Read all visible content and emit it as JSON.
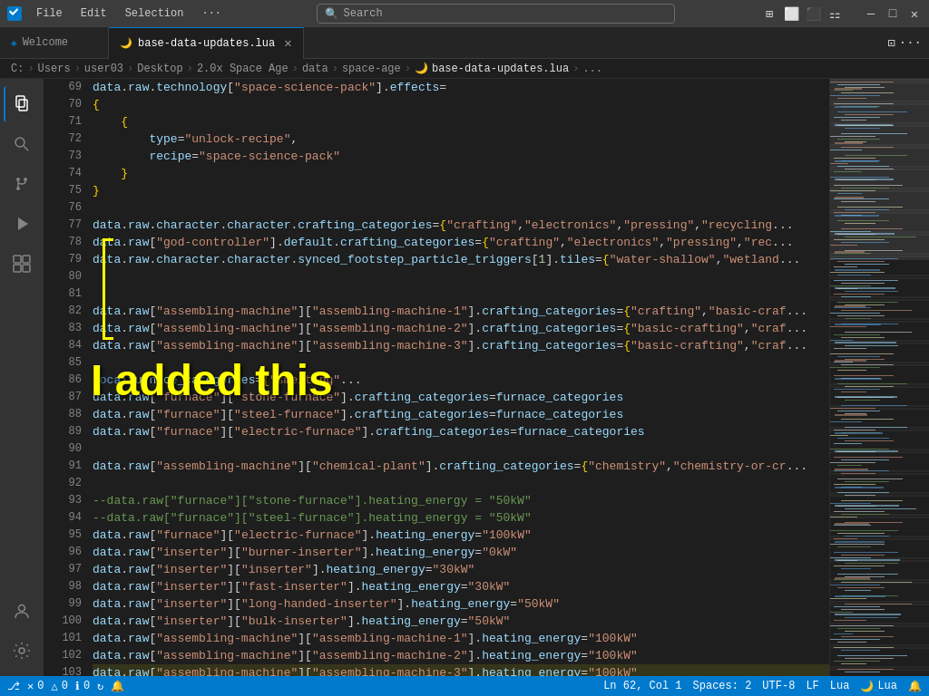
{
  "titleBar": {
    "appIcon": "vscode-icon",
    "menus": [
      "File",
      "Edit",
      "Selection",
      "..."
    ],
    "searchPlaceholder": "Search",
    "windowControls": [
      "minimize",
      "maximize-restore",
      "close"
    ]
  },
  "tabs": [
    {
      "id": "welcome",
      "label": "Welcome",
      "icon": "vscode-icon",
      "active": false,
      "closable": false
    },
    {
      "id": "base-data-updates",
      "label": "base-data-updates.lua",
      "icon": "lua-icon",
      "active": true,
      "closable": true
    }
  ],
  "breadcrumb": {
    "parts": [
      "C:",
      "Users",
      "user03",
      "Desktop",
      "2.0x Space Age",
      "data",
      "space-age",
      "base-data-updates.lua",
      "..."
    ]
  },
  "lines": [
    {
      "num": 69,
      "code": "data.raw.technology[\"space-science-pack\"].effects ="
    },
    {
      "num": 70,
      "code": "{"
    },
    {
      "num": 71,
      "code": "  {"
    },
    {
      "num": 72,
      "code": "    type = \"unlock-recipe\","
    },
    {
      "num": 73,
      "code": "    recipe = \"space-science-pack\""
    },
    {
      "num": 74,
      "code": "  }"
    },
    {
      "num": 75,
      "code": "}"
    },
    {
      "num": 76,
      "code": ""
    },
    {
      "num": 77,
      "code": "data.raw.character.character.crafting_categories = {\"crafting\", \"electronics\", \"pressing\", \"recycling..."
    },
    {
      "num": 78,
      "code": "data.raw[\"god-controller\"].default.crafting_categories = {\"crafting\", \"electronics\", \"pressing\", \"rec..."
    },
    {
      "num": 79,
      "code": "data.raw.character.character.synced_footstep_particle_triggers[1].tiles = { \"water-shallow\", \"wetland..."
    },
    {
      "num": 80,
      "code": ""
    },
    {
      "num": 81,
      "code": ""
    },
    {
      "num": 82,
      "code": "data.raw[\"assembling-machine\"][\"assembling-machine-1\"].crafting_categories = {\"crafting\", \"basic-craf..."
    },
    {
      "num": 83,
      "code": "data.raw[\"assembling-machine\"][\"assembling-machine-2\"].crafting_categories = {\"basic-crafting\", \"craf..."
    },
    {
      "num": 84,
      "code": "data.raw[\"assembling-machine\"][\"assembling-machine-3\"].crafting_categories = {\"basic-crafting\", \"craf..."
    },
    {
      "num": 85,
      "code": ""
    },
    {
      "num": 86,
      "code": "local furnace_categories = {\"smelting\"..."
    },
    {
      "num": 87,
      "code": "data.raw[\"furnace\"][\"stone-furnace\"].crafting_categories = furnace_categories"
    },
    {
      "num": 88,
      "code": "data.raw[\"furnace\"][\"steel-furnace\"].crafting_categories = furnace_categories"
    },
    {
      "num": 89,
      "code": "data.raw[\"furnace\"][\"electric-furnace\"].crafting_categories = furnace_categories"
    },
    {
      "num": 90,
      "code": ""
    },
    {
      "num": 91,
      "code": "data.raw[\"assembling-machine\"][\"chemical-plant\"].crafting_categories = {\"chemistry\", \"chemistry-or-cr..."
    },
    {
      "num": 92,
      "code": ""
    },
    {
      "num": 93,
      "code": "--data.raw[\"furnace\"][\"stone-furnace\"].heating_energy = \"50kW\""
    },
    {
      "num": 94,
      "code": "--data.raw[\"furnace\"][\"steel-furnace\"].heating_energy = \"50kW\""
    },
    {
      "num": 95,
      "code": "data.raw[\"furnace\"][\"electric-furnace\"].heating_energy = \"100kW\""
    },
    {
      "num": 96,
      "code": "data.raw[\"inserter\"][\"burner-inserter\"].heating_energy = \"0kW\""
    },
    {
      "num": 97,
      "code": "data.raw[\"inserter\"][\"inserter\"].heating_energy = \"30kW\""
    },
    {
      "num": 98,
      "code": "data.raw[\"inserter\"][\"fast-inserter\"].heating_energy = \"30kW\""
    },
    {
      "num": 99,
      "code": "data.raw[\"inserter\"][\"long-handed-inserter\"].heating_energy = \"50kW\""
    },
    {
      "num": 100,
      "code": "data.raw[\"inserter\"][\"bulk-inserter\"].heating_energy = \"50kW\""
    },
    {
      "num": 101,
      "code": "data.raw[\"assembling-machine\"][\"assembling-machine-1\"].heating_energy = \"100kW\""
    },
    {
      "num": 102,
      "code": "data.raw[\"assembling-machine\"][\"assembling-machine-2\"].heating_energy = \"100kW\""
    },
    {
      "num": 103,
      "code": "data.raw[\"assembling-machine\"][\"assembling-machine-3\"].heating_energy = \"100kW\""
    }
  ],
  "annotation": {
    "text": "I  added this",
    "color": "#ffff00"
  },
  "statusBar": {
    "errors": "0",
    "warnings": "0",
    "info": "0",
    "syncIcon": true,
    "position": "Ln 62, Col 1",
    "spaces": "Spaces: 2",
    "encoding": "UTF-8",
    "lineEnding": "LF",
    "language": "Lua",
    "notifications": "Lua"
  },
  "activityBar": {
    "items": [
      {
        "id": "explorer",
        "icon": "📄",
        "label": "Explorer"
      },
      {
        "id": "search",
        "icon": "🔍",
        "label": "Search"
      },
      {
        "id": "source-control",
        "icon": "⎇",
        "label": "Source Control"
      },
      {
        "id": "run",
        "icon": "▷",
        "label": "Run"
      },
      {
        "id": "extensions",
        "icon": "⊞",
        "label": "Extensions"
      }
    ],
    "bottomItems": [
      {
        "id": "accounts",
        "icon": "👤",
        "label": "Accounts"
      },
      {
        "id": "settings",
        "icon": "⚙",
        "label": "Settings"
      }
    ]
  }
}
